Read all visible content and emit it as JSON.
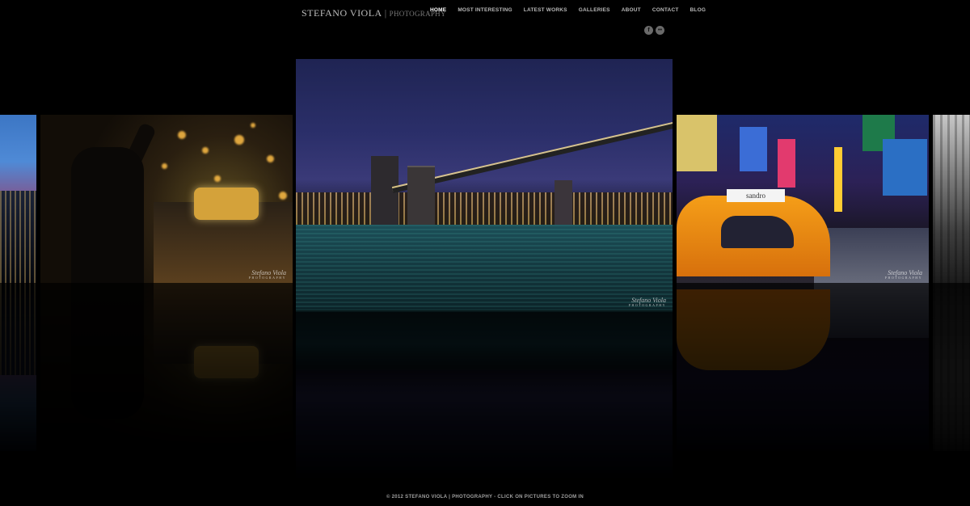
{
  "header": {
    "logo_name": "STEFANO VIOLA",
    "logo_sep": "|",
    "logo_sub": "PHOTOGRAPHY"
  },
  "nav": [
    {
      "label": "HOME",
      "active": true
    },
    {
      "label": "MOST INTERESTING",
      "active": false
    },
    {
      "label": "LATEST WORKS",
      "active": false
    },
    {
      "label": "GALLERIES",
      "active": false
    },
    {
      "label": "ABOUT",
      "active": false
    },
    {
      "label": "CONTACT",
      "active": false
    },
    {
      "label": "BLOG",
      "active": false
    }
  ],
  "social": [
    {
      "icon": "facebook-icon",
      "glyph": "f"
    },
    {
      "icon": "flickr-icon",
      "glyph": "••"
    }
  ],
  "watermark": {
    "name": "Stefano Viola",
    "sub": "PHOTOGRAPHY"
  },
  "gallery": [
    {
      "name": "photo-city-skyline",
      "subject": "city skyline at dusk"
    },
    {
      "name": "photo-hailing-taxi",
      "subject": "man hailing taxi at night"
    },
    {
      "name": "photo-brooklyn-bridge",
      "subject": "Brooklyn Bridge at night"
    },
    {
      "name": "photo-times-square-taxi",
      "subject": "taxi in Times Square"
    },
    {
      "name": "photo-black-white-building",
      "subject": "black and white building"
    }
  ],
  "times_square_taxi_sign": "sandro",
  "footer": "© 2012 STEFANO VIOLA | PHOTOGRAPHY - CLICK ON PICTURES TO ZOOM IN"
}
